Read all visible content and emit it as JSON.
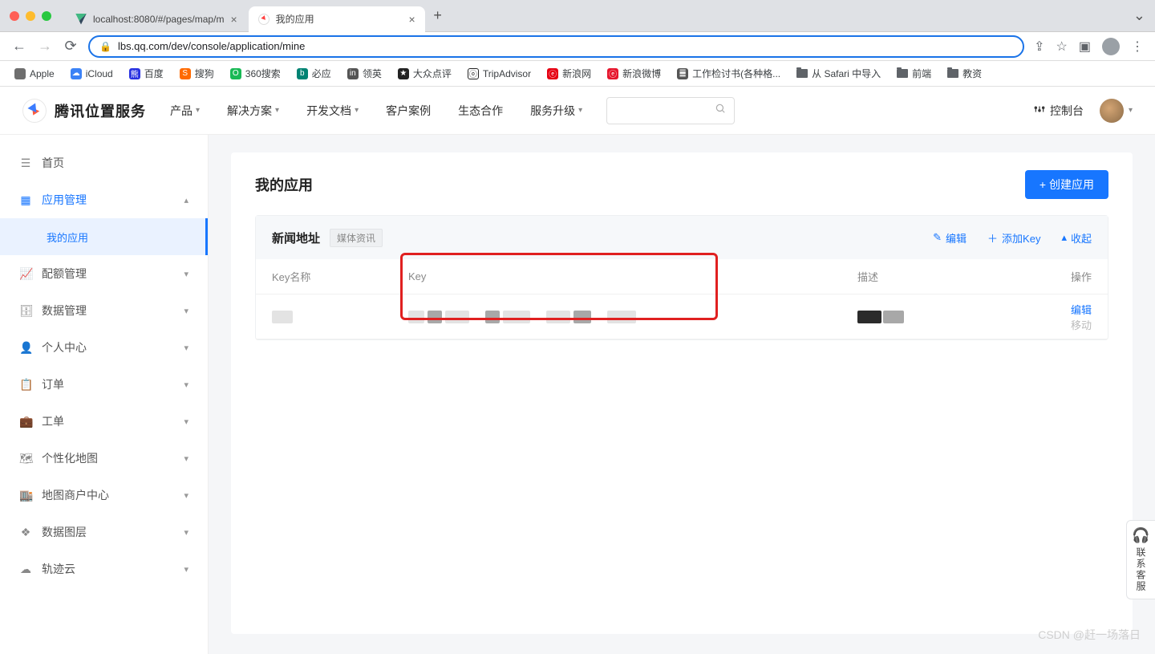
{
  "browser": {
    "tabs": [
      {
        "title": "localhost:8080/#/pages/map/m"
      },
      {
        "title": "我的应用"
      }
    ],
    "url": "lbs.qq.com/dev/console/application/mine",
    "bookmarks": [
      {
        "label": "Apple",
        "color": "#6e6e6e",
        "glyph": ""
      },
      {
        "label": "iCloud",
        "color": "#3b82f6",
        "glyph": "☁"
      },
      {
        "label": "百度",
        "color": "#2932e1",
        "glyph": "熊"
      },
      {
        "label": "搜狗",
        "color": "#ff6a00",
        "glyph": "S"
      },
      {
        "label": "360搜索",
        "color": "#19b955",
        "glyph": "O"
      },
      {
        "label": "必应",
        "color": "#008373",
        "glyph": "b"
      },
      {
        "label": "领英",
        "color": "#555",
        "glyph": "in"
      },
      {
        "label": "大众点评",
        "color": "#222",
        "glyph": "★"
      },
      {
        "label": "TripAdvisor",
        "color": "#222",
        "glyph": "ⓞ"
      },
      {
        "label": "新浪网",
        "color": "#e60012",
        "glyph": "ⓔ"
      },
      {
        "label": "新浪微博",
        "color": "#e6162d",
        "glyph": "ⓔ"
      },
      {
        "label": "工作检讨书(各种格...",
        "color": "#555",
        "glyph": "䷀"
      },
      {
        "label": "从 Safari 中导入",
        "folder": true
      },
      {
        "label": "前端",
        "folder": true
      },
      {
        "label": "教资",
        "folder": true
      }
    ]
  },
  "header": {
    "brand": "腾讯位置服务",
    "nav": [
      "产品",
      "解决方案",
      "开发文档",
      "客户案例",
      "生态合作",
      "服务升级"
    ],
    "console": "控制台"
  },
  "sidebar": {
    "items": [
      {
        "icon": "list",
        "label": "首页"
      },
      {
        "icon": "grid",
        "label": "应用管理",
        "expanded": true,
        "active": true
      },
      {
        "icon": "chart",
        "label": "配额管理"
      },
      {
        "icon": "db",
        "label": "数据管理"
      },
      {
        "icon": "user",
        "label": "个人中心"
      },
      {
        "icon": "clip",
        "label": "订单"
      },
      {
        "icon": "bag",
        "label": "工单"
      },
      {
        "icon": "map",
        "label": "个性化地图"
      },
      {
        "icon": "store",
        "label": "地图商户中心"
      },
      {
        "icon": "layers",
        "label": "数据图层"
      },
      {
        "icon": "cloud",
        "label": "轨迹云"
      }
    ],
    "sub_my_app": "我的应用"
  },
  "page": {
    "title": "我的应用",
    "create_btn": "+ 创建应用",
    "card": {
      "title": "新闻地址",
      "tag": "媒体资讯",
      "actions": {
        "edit": "编辑",
        "addkey": "添加Key",
        "collapse": "收起"
      }
    },
    "table": {
      "headers": {
        "name": "Key名称",
        "key": "Key",
        "desc": "描述",
        "op": "操作"
      },
      "row_ops": {
        "edit": "编辑",
        "move": "移动"
      }
    }
  },
  "float_cs": "联系客服",
  "watermark": "CSDN @赶一场落日"
}
